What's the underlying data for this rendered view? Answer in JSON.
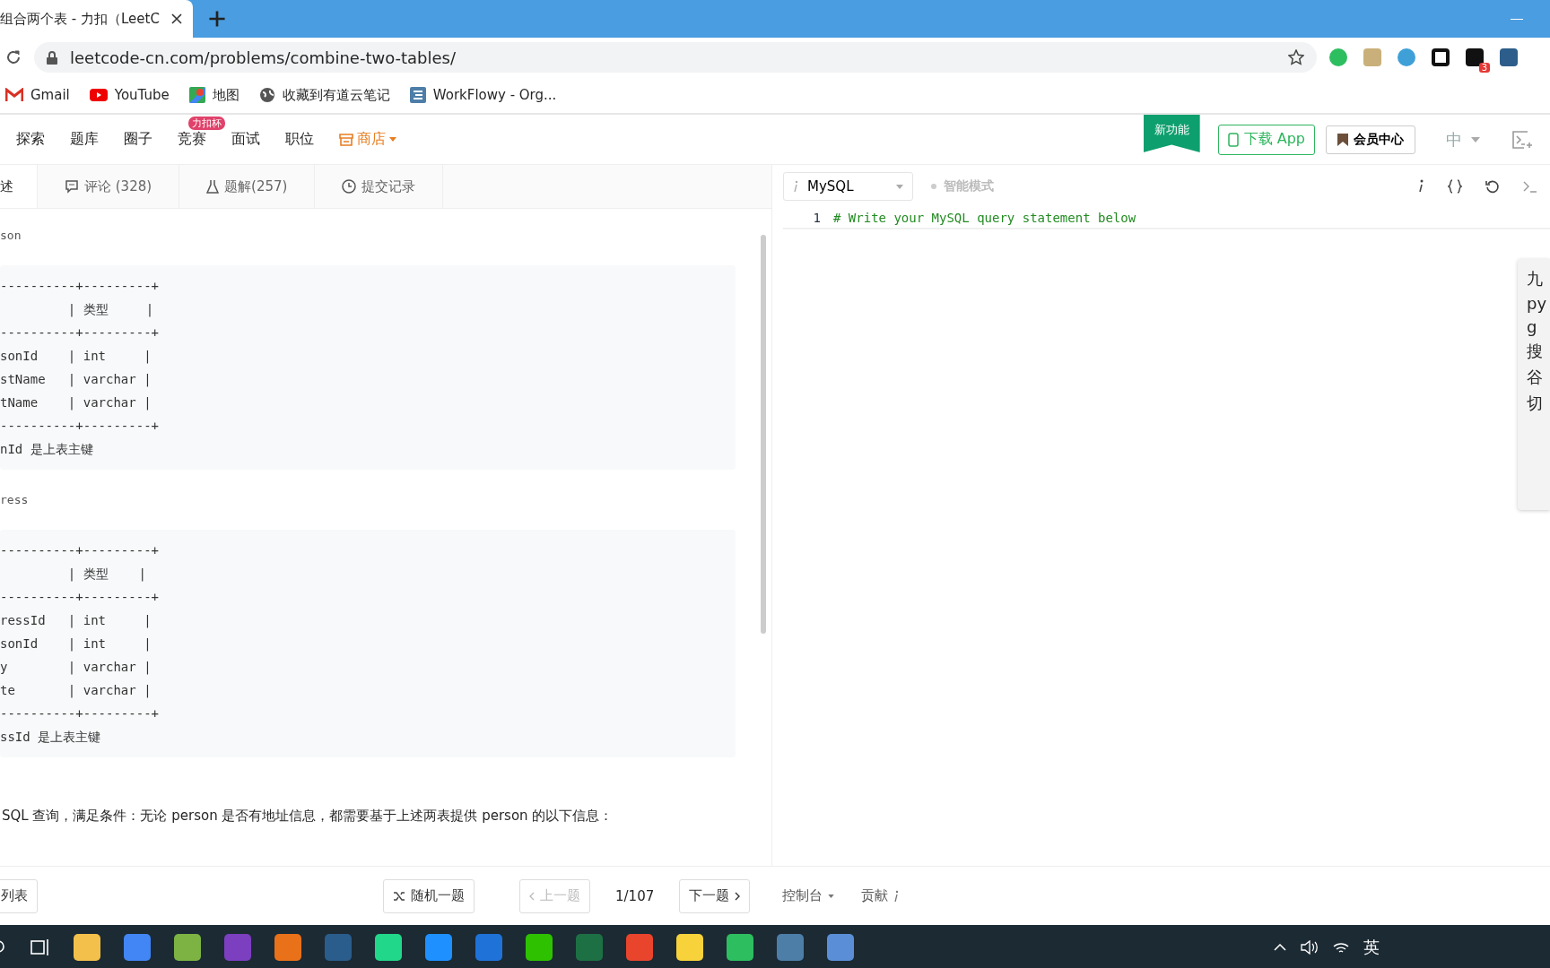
{
  "browser": {
    "tab_title": "组合两个表 - 力扣（LeetC",
    "url": "leetcode-cn.com/problems/combine-two-tables/",
    "extension_badge": "3",
    "bookmarks": [
      {
        "label": "Gmail",
        "kind": "mail"
      },
      {
        "label": "YouTube",
        "kind": "video"
      },
      {
        "label": "地图",
        "kind": "map"
      },
      {
        "label": "收藏到有道云笔记",
        "kind": "globe"
      },
      {
        "label": "WorkFlowy - Org...",
        "kind": "list"
      }
    ]
  },
  "site_nav": {
    "items": [
      {
        "label": "探索",
        "kind": "link"
      },
      {
        "label": "题库",
        "kind": "link"
      },
      {
        "label": "圈子",
        "kind": "link"
      },
      {
        "label": "竞赛",
        "kind": "link",
        "badge": "力扣杯"
      },
      {
        "label": "面试",
        "kind": "link"
      },
      {
        "label": "职位",
        "kind": "link"
      },
      {
        "label": "商店",
        "kind": "store"
      }
    ],
    "new_feature": "新功能",
    "download_button": "下载 App",
    "member_button": "会员中心",
    "language": "中"
  },
  "problem_tabs": [
    {
      "label": "述",
      "kind": "plain",
      "selected": true
    },
    {
      "label": "评论 (328)",
      "kind": "comment",
      "selected": false
    },
    {
      "label": "题解(257)",
      "kind": "flask",
      "selected": false
    },
    {
      "label": "提交记录",
      "kind": "clock",
      "selected": false
    }
  ],
  "description": [
    {
      "kind": "label",
      "text": "son"
    },
    {
      "kind": "code_block",
      "lines": [
        "----------+---------+",
        "         | 类型     |",
        "----------+---------+",
        "sonId    | int     |",
        "stName   | varchar |",
        "tName    | varchar |",
        "----------+---------+",
        "nId 是上表主键"
      ]
    },
    {
      "kind": "label",
      "text": "ress"
    },
    {
      "kind": "code_block",
      "lines": [
        "----------+---------+",
        "         | 类型    |",
        "----------+---------+",
        "ressId   | int     |",
        "sonId    | int     |",
        "y        | varchar |",
        "te       | varchar |",
        "----------+---------+",
        "ssId 是上表主键"
      ]
    },
    {
      "kind": "paragraph",
      "text": "SQL 查询，满足条件：无论 person 是否有地址信息，都需要基于上述两表提供 person 的以下信息："
    }
  ],
  "editor": {
    "language": "MySQL",
    "smart_mode": "智能模式",
    "lines": [
      {
        "number": "1",
        "code": "# Write your MySQL query statement below"
      }
    ]
  },
  "side_panel": {
    "lines": [
      "九",
      "py",
      "g",
      "搜",
      "谷",
      "切"
    ]
  },
  "footer": {
    "list_button": "列表",
    "random_button": "随机一题",
    "prev_button": {
      "label": "上一题",
      "disabled": true
    },
    "counter": "1/107",
    "next_button": {
      "label": "下一题",
      "disabled": false
    },
    "console": "控制台",
    "contribute": "贡献"
  },
  "taskbar": {
    "ime": "英"
  }
}
